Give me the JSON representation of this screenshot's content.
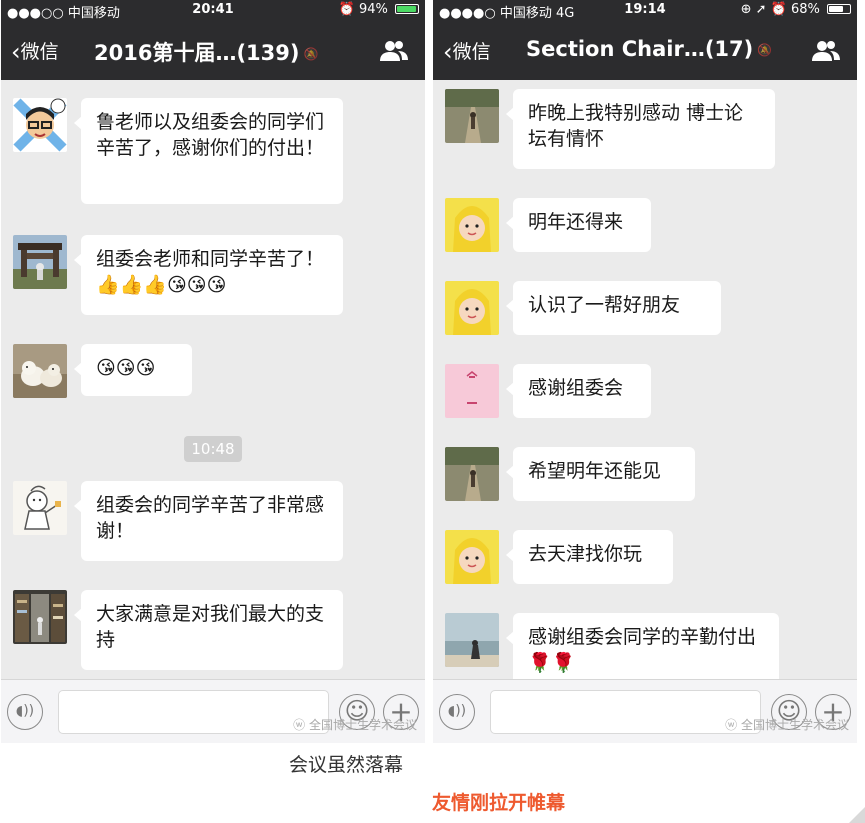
{
  "left_phone": {
    "status": {
      "carrier": "●●●○○ 中国移动",
      "wifi_icon": "wifi-icon",
      "time": "20:41",
      "battery_percent_label": "94%",
      "battery_level": 0.94
    },
    "nav": {
      "back_label": "微信",
      "title": "2016第十届…(139)",
      "mute_icon": "mute-bell-icon",
      "group_icon": "group-members-icon"
    },
    "messages": [
      {
        "text": "鲁老师以及组委会的同学们辛苦了，感谢你们的付出！"
      },
      {
        "text": "组委会老师和同学辛苦了！👍👍👍😘😘😘"
      },
      {
        "text": "😘😘😘"
      },
      {
        "text": "组委会的同学辛苦了非常感谢！"
      },
      {
        "text": "大家满意是对我们最大的支持"
      }
    ],
    "timestamp": "10:48",
    "watermark": "全国博士生学术会议"
  },
  "right_phone": {
    "status": {
      "carrier": "●●●●○ 中国移动 4G",
      "time": "19:14",
      "icons": "⊕ ➚ ⏰",
      "battery_percent_label": "68%",
      "battery_level": 0.68
    },
    "nav": {
      "back_label": "微信",
      "title": "Section Chair…(17)",
      "mute_icon": "mute-bell-icon",
      "group_icon": "group-members-icon"
    },
    "messages": [
      {
        "text": "昨晚上我特别感动 博士论坛有情怀"
      },
      {
        "text": "明年还得来"
      },
      {
        "text": "认识了一帮好朋友"
      },
      {
        "text": "感谢组委会"
      },
      {
        "text": "希望明年还能见"
      },
      {
        "text": "去天津找你玩"
      },
      {
        "text": "感谢组委会同学的辛勤付出🌹🌹"
      }
    ],
    "watermark": "全国博士生学术会议"
  },
  "captions": {
    "line1": "会议虽然落幕",
    "line2": "友情刚拉开帷幕"
  },
  "colors": {
    "nav_bg": "#2c2c2e",
    "chat_bg": "#ebebeb",
    "bubble_bg": "#ffffff",
    "caption_accent": "#ee5a2f",
    "battery_green": "#4cd964"
  }
}
